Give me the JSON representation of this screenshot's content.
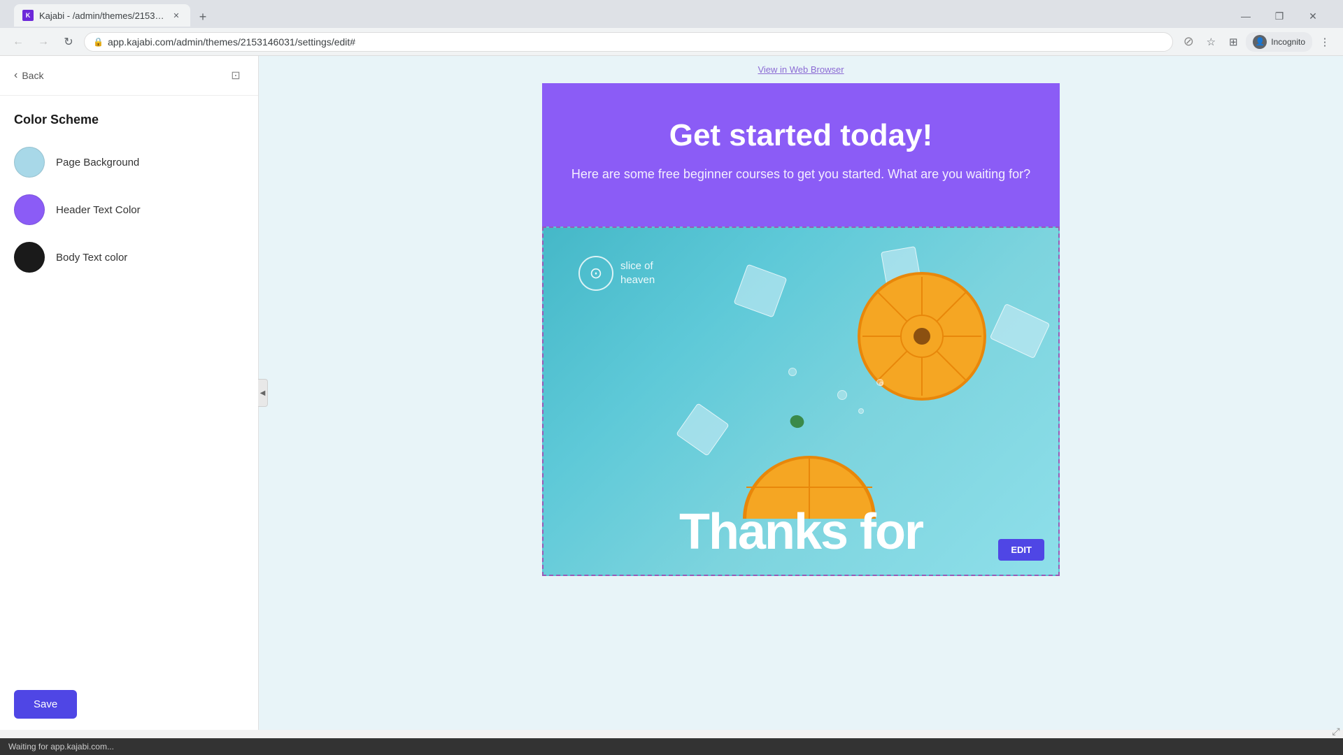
{
  "browser": {
    "tab_title": "Kajabi - /admin/themes/2153146…",
    "tab_favicon": "K",
    "url": "app.kajabi.com/admin/themes/2153146031/settings/edit#",
    "url_full": "https://app.kajabi.com/admin/themes/2153146031/settings/edit#",
    "incognito_label": "Incognito"
  },
  "sidebar": {
    "back_label": "Back",
    "section_title": "Color Scheme",
    "color_items": [
      {
        "label": "Page Background",
        "color": "#a8d8e8",
        "id": "page-background"
      },
      {
        "label": "Header Text Color",
        "color": "#8b5cf6",
        "id": "header-text-color"
      },
      {
        "label": "Body Text color",
        "color": "#1a1a1a",
        "id": "body-text-color"
      }
    ],
    "save_label": "Save"
  },
  "preview": {
    "view_in_browser": "View in Web Browser",
    "hero_title": "Get started today!",
    "hero_subtitle": "Here are some free beginner courses to get you started. What are you waiting for?",
    "logo_text": "slice of\nheaven",
    "thanks_text": "Thanks for",
    "edit_button": "EDIT"
  },
  "status_bar": {
    "text": "Waiting for app.kajabi.com..."
  },
  "icons": {
    "back_arrow": "‹",
    "external_link": "⊡",
    "nav_back": "←",
    "nav_forward": "→",
    "refresh": "↻",
    "lock": "🔒",
    "star": "☆",
    "extension": "⊞",
    "menu": "⋮",
    "camera_off": "⊘",
    "collapse": "◀",
    "resize": "⤢",
    "orange": "🍊",
    "citrus": "⊙"
  }
}
